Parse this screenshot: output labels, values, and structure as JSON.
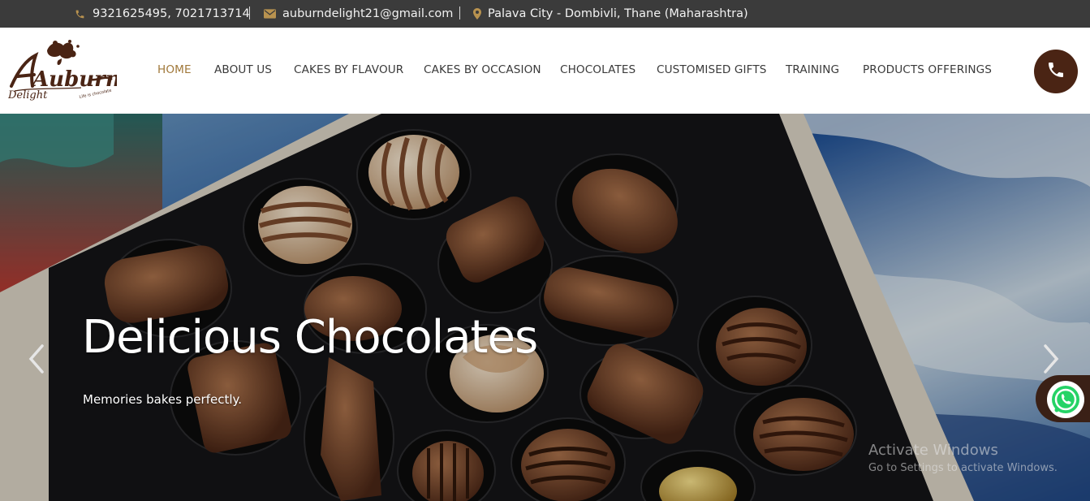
{
  "topbar": {
    "phone": "9321625495, 7021713714",
    "email": "auburndelight21@gmail.com",
    "location": "Palava City - Dombivli, Thane (Maharashtra)"
  },
  "logo": {
    "brand_main": "Auburn",
    "brand_sub": "Delight",
    "tagline": "Life is chocolate"
  },
  "nav": {
    "items": [
      {
        "label": "HOME",
        "active": true
      },
      {
        "label": "ABOUT US"
      },
      {
        "label": "CAKES BY FLAVOUR"
      },
      {
        "label": "CAKES BY OCCASION"
      },
      {
        "label": "CHOCOLATES"
      },
      {
        "label": "CUSTOMISED GIFTS"
      },
      {
        "label": "TRAINING"
      },
      {
        "label": "PRODUCTS OFFERINGS"
      }
    ],
    "phone_icon": "phone-icon"
  },
  "hero": {
    "title": "Delicious Chocolates",
    "subtitle": "Memories bakes perfectly.",
    "prev_icon": "chevron-left-icon",
    "next_icon": "chevron-right-icon",
    "whatsapp_icon": "whatsapp-icon"
  },
  "watermark": {
    "line1": "Activate Windows",
    "line2": "Go to Settings to activate Windows."
  },
  "colors": {
    "topbar_bg": "#3b3b3b",
    "icon_gold": "#b8924f",
    "nav_active": "#a0783a",
    "brand_brown": "#4a2414"
  }
}
